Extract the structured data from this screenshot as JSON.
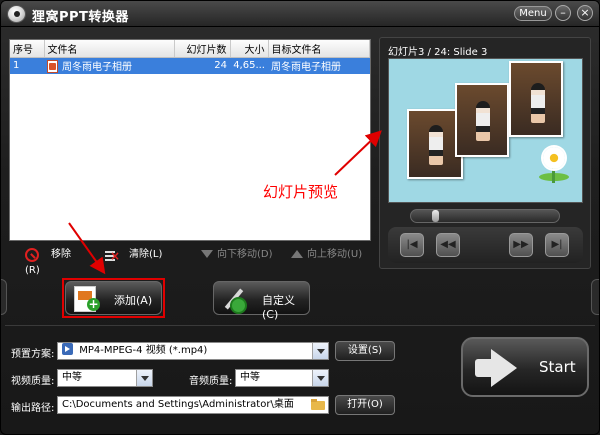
{
  "window": {
    "title": "狸窝PPT转换器",
    "menu_label": "Menu",
    "minimize_glyph": "–",
    "close_glyph": "×"
  },
  "file_table": {
    "columns": [
      "序号",
      "文件名",
      "幻灯片数",
      "大小",
      "目标文件名"
    ],
    "rows": [
      {
        "index": "1",
        "filename": "周冬雨电子相册",
        "slides": "24",
        "size": "4,65...",
        "target": "周冬雨电子相册"
      }
    ],
    "selected_row": 0
  },
  "list_actions": {
    "remove": "移除(R)",
    "clear": "清除(L)",
    "move_down": "向下移动(D)",
    "move_up": "向上移动(U)"
  },
  "preview": {
    "caption": "幻灯片3 / 24: Slide 3",
    "playback_position": 0.08,
    "controls": [
      {
        "name": "first-slide",
        "glyph": "|◀"
      },
      {
        "name": "prev-slide",
        "glyph": "◀◀"
      },
      {
        "name": "next-slide",
        "glyph": "▶▶"
      },
      {
        "name": "last-slide",
        "glyph": "▶|"
      }
    ]
  },
  "annotation": {
    "preview_note": "幻灯片预览",
    "color": "#ff0000"
  },
  "buttons": {
    "add": "添加(A)",
    "customize": "自定义(C)"
  },
  "settings": {
    "preset_label": "预置方案:",
    "preset_value": "MP4-MPEG-4 视频 (*.mp4)",
    "preset_button": "设置(S)",
    "video_quality_label": "视频质量:",
    "video_quality_value": "中等",
    "audio_quality_label": "音频质量:",
    "audio_quality_value": "中等",
    "output_label": "输出路径:",
    "output_value": "C:\\Documents and Settings\\Administrator\\桌面",
    "open_button": "打开(O)"
  },
  "start_button": "Start",
  "colors": {
    "selection": "#3a7fdc",
    "annotation_red": "#e00000",
    "background": "#1e1e1e"
  }
}
